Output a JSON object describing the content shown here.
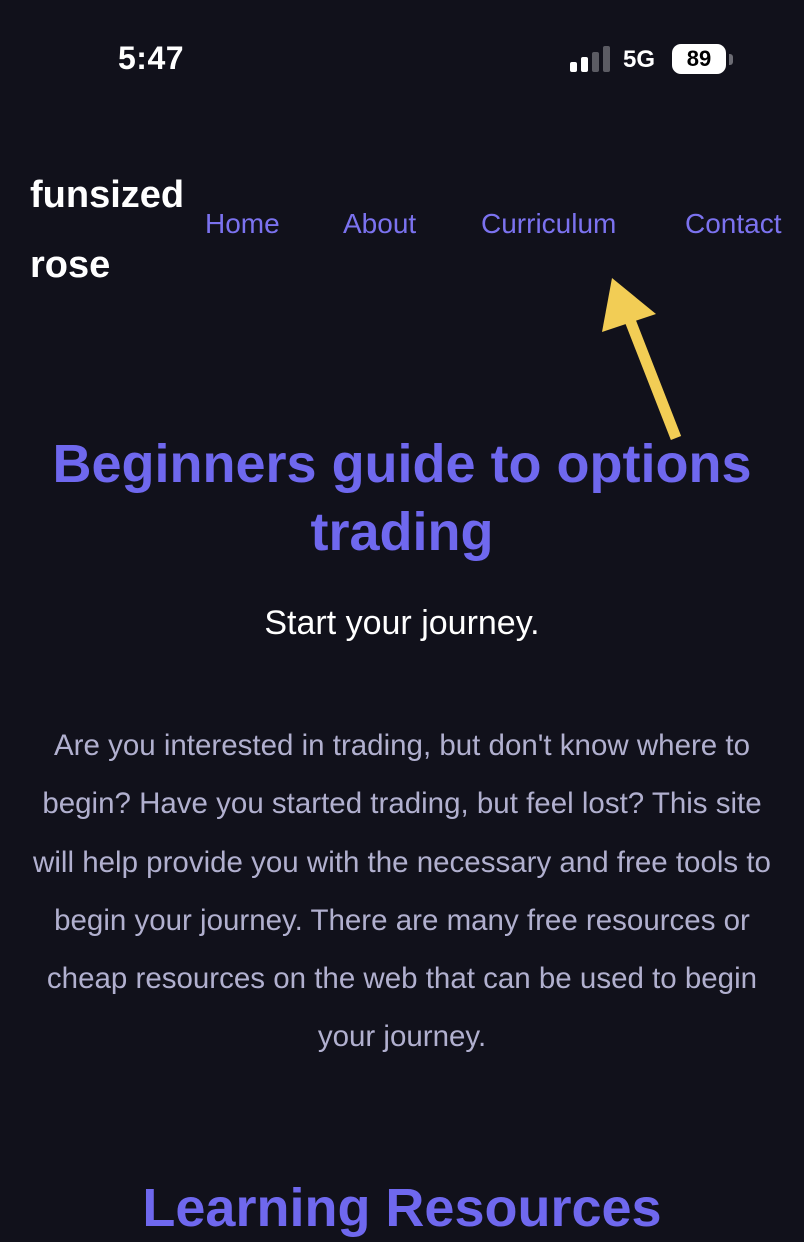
{
  "status_bar": {
    "time": "5:47",
    "network": "5G",
    "battery": "89"
  },
  "site": {
    "logo_line1": "funsized",
    "logo_line2": "rose"
  },
  "nav": {
    "items": [
      {
        "label": "Home"
      },
      {
        "label": "About"
      },
      {
        "label": "Curriculum"
      },
      {
        "label": "Contact"
      }
    ]
  },
  "annotation": {
    "icon": "arrow-up-icon",
    "color": "#f2cd55"
  },
  "hero": {
    "title": "Beginners guide to options trading",
    "subtitle": "Start your journey.",
    "paragraph": "Are you interested in trading, but don't know where to begin? Have you started trading, but feel lost? This site will help provide you with the necessary and free tools to begin your journey. There are many free resources or cheap resources on the web that can be used to begin your journey.",
    "next_heading": "Learning Resources"
  },
  "colors": {
    "background": "#11111b",
    "accent": "#6f68ee",
    "body_text": "#b1b0cf"
  }
}
